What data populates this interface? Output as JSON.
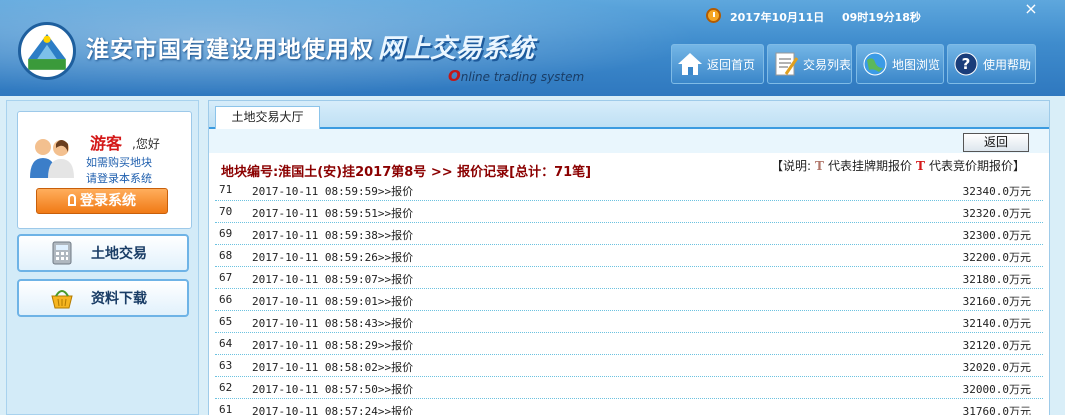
{
  "header": {
    "title_main": "淮安市国有建设用地使用权",
    "title_em": "网上交易系统",
    "subtitle_first": "O",
    "subtitle_rest": "nline trading system",
    "date": "2017年10月11日",
    "time": "09时19分18秒",
    "close_label": "×",
    "nav": [
      {
        "label": "返回首页",
        "icon": "home-icon"
      },
      {
        "label": "交易列表",
        "icon": "list-icon"
      },
      {
        "label": "地图浏览",
        "icon": "globe-icon"
      },
      {
        "label": "使用帮助",
        "icon": "help-icon"
      }
    ]
  },
  "sidebar": {
    "guest_name": "游客",
    "guest_hello": ",您好",
    "guest_line1": "如需购买地块",
    "guest_line2": "请登录本系统",
    "login_label": "登录系统",
    "buttons": [
      {
        "label": "土地交易",
        "icon": "calculator-icon"
      },
      {
        "label": "资料下载",
        "icon": "basket-icon"
      }
    ]
  },
  "main": {
    "tab_label": "土地交易大厅",
    "back_label": "返回",
    "record_title": "地块编号:淮国土(安)挂2017第8号 >> 报价记录[总计：71笔]",
    "legend_prefix": "【说明:",
    "legend_t1": "T",
    "legend_t1_text": "代表挂牌期报价",
    "legend_t2": "T",
    "legend_t2_text": "代表竞价期报价】",
    "records": [
      {
        "num": "71",
        "time": "2017-10-11 08:59:59>>报价",
        "price": "32340.0万元"
      },
      {
        "num": "70",
        "time": "2017-10-11 08:59:51>>报价",
        "price": "32320.0万元"
      },
      {
        "num": "69",
        "time": "2017-10-11 08:59:38>>报价",
        "price": "32300.0万元"
      },
      {
        "num": "68",
        "time": "2017-10-11 08:59:26>>报价",
        "price": "32200.0万元"
      },
      {
        "num": "67",
        "time": "2017-10-11 08:59:07>>报价",
        "price": "32180.0万元"
      },
      {
        "num": "66",
        "time": "2017-10-11 08:59:01>>报价",
        "price": "32160.0万元"
      },
      {
        "num": "65",
        "time": "2017-10-11 08:58:43>>报价",
        "price": "32140.0万元"
      },
      {
        "num": "64",
        "time": "2017-10-11 08:58:29>>报价",
        "price": "32120.0万元"
      },
      {
        "num": "63",
        "time": "2017-10-11 08:58:02>>报价",
        "price": "32020.0万元"
      },
      {
        "num": "62",
        "time": "2017-10-11 08:57:50>>报价",
        "price": "32000.0万元"
      },
      {
        "num": "61",
        "time": "2017-10-11 08:57:24>>报价",
        "price": "31760.0万元"
      }
    ]
  },
  "colors": {
    "header_blue": "#3f8ccd",
    "title_red": "#8b0000",
    "guest_red": "#d41818",
    "login_orange": "#f07a16"
  }
}
